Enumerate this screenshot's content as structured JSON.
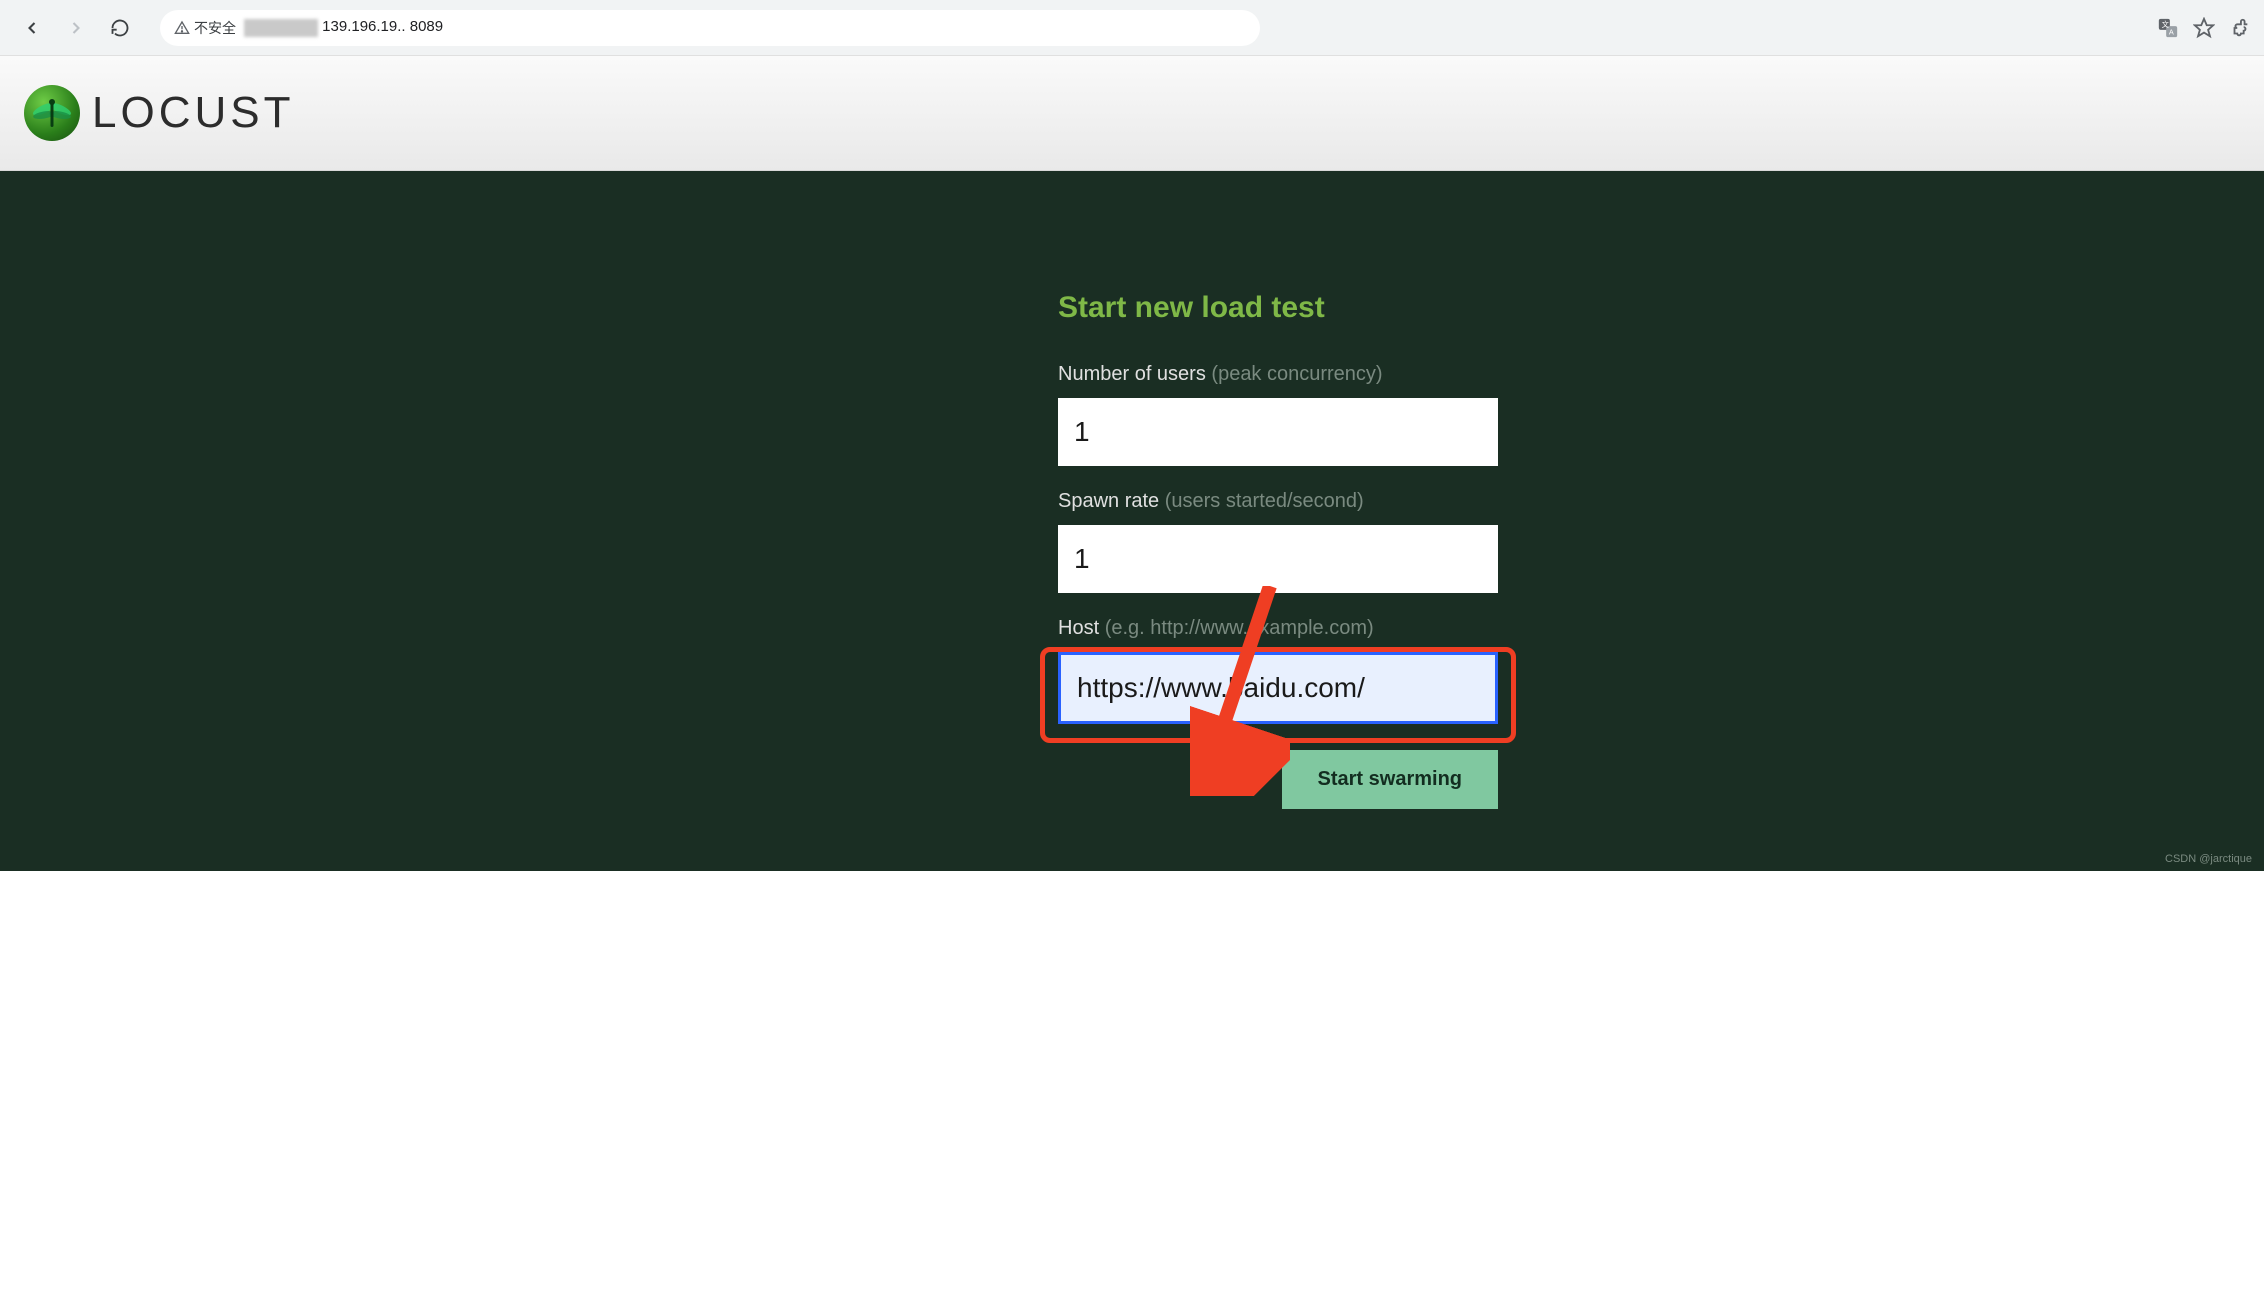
{
  "browser": {
    "security_label": "不安全",
    "url_prefix_redacted": true,
    "url_visible": "139.196.19..  8089"
  },
  "header": {
    "wordmark": "LOCUST"
  },
  "form": {
    "title": "Start new load test",
    "users_label": "Number of users",
    "users_hint": "(peak concurrency)",
    "users_value": "1",
    "spawn_label": "Spawn rate",
    "spawn_hint": "(users started/second)",
    "spawn_value": "1",
    "host_label": "Host",
    "host_hint": "(e.g. http://www.example.com)",
    "host_value": "https://www.baidu.com/",
    "submit_label": "Start swarming"
  },
  "watermark": "CSDN @jarctique"
}
